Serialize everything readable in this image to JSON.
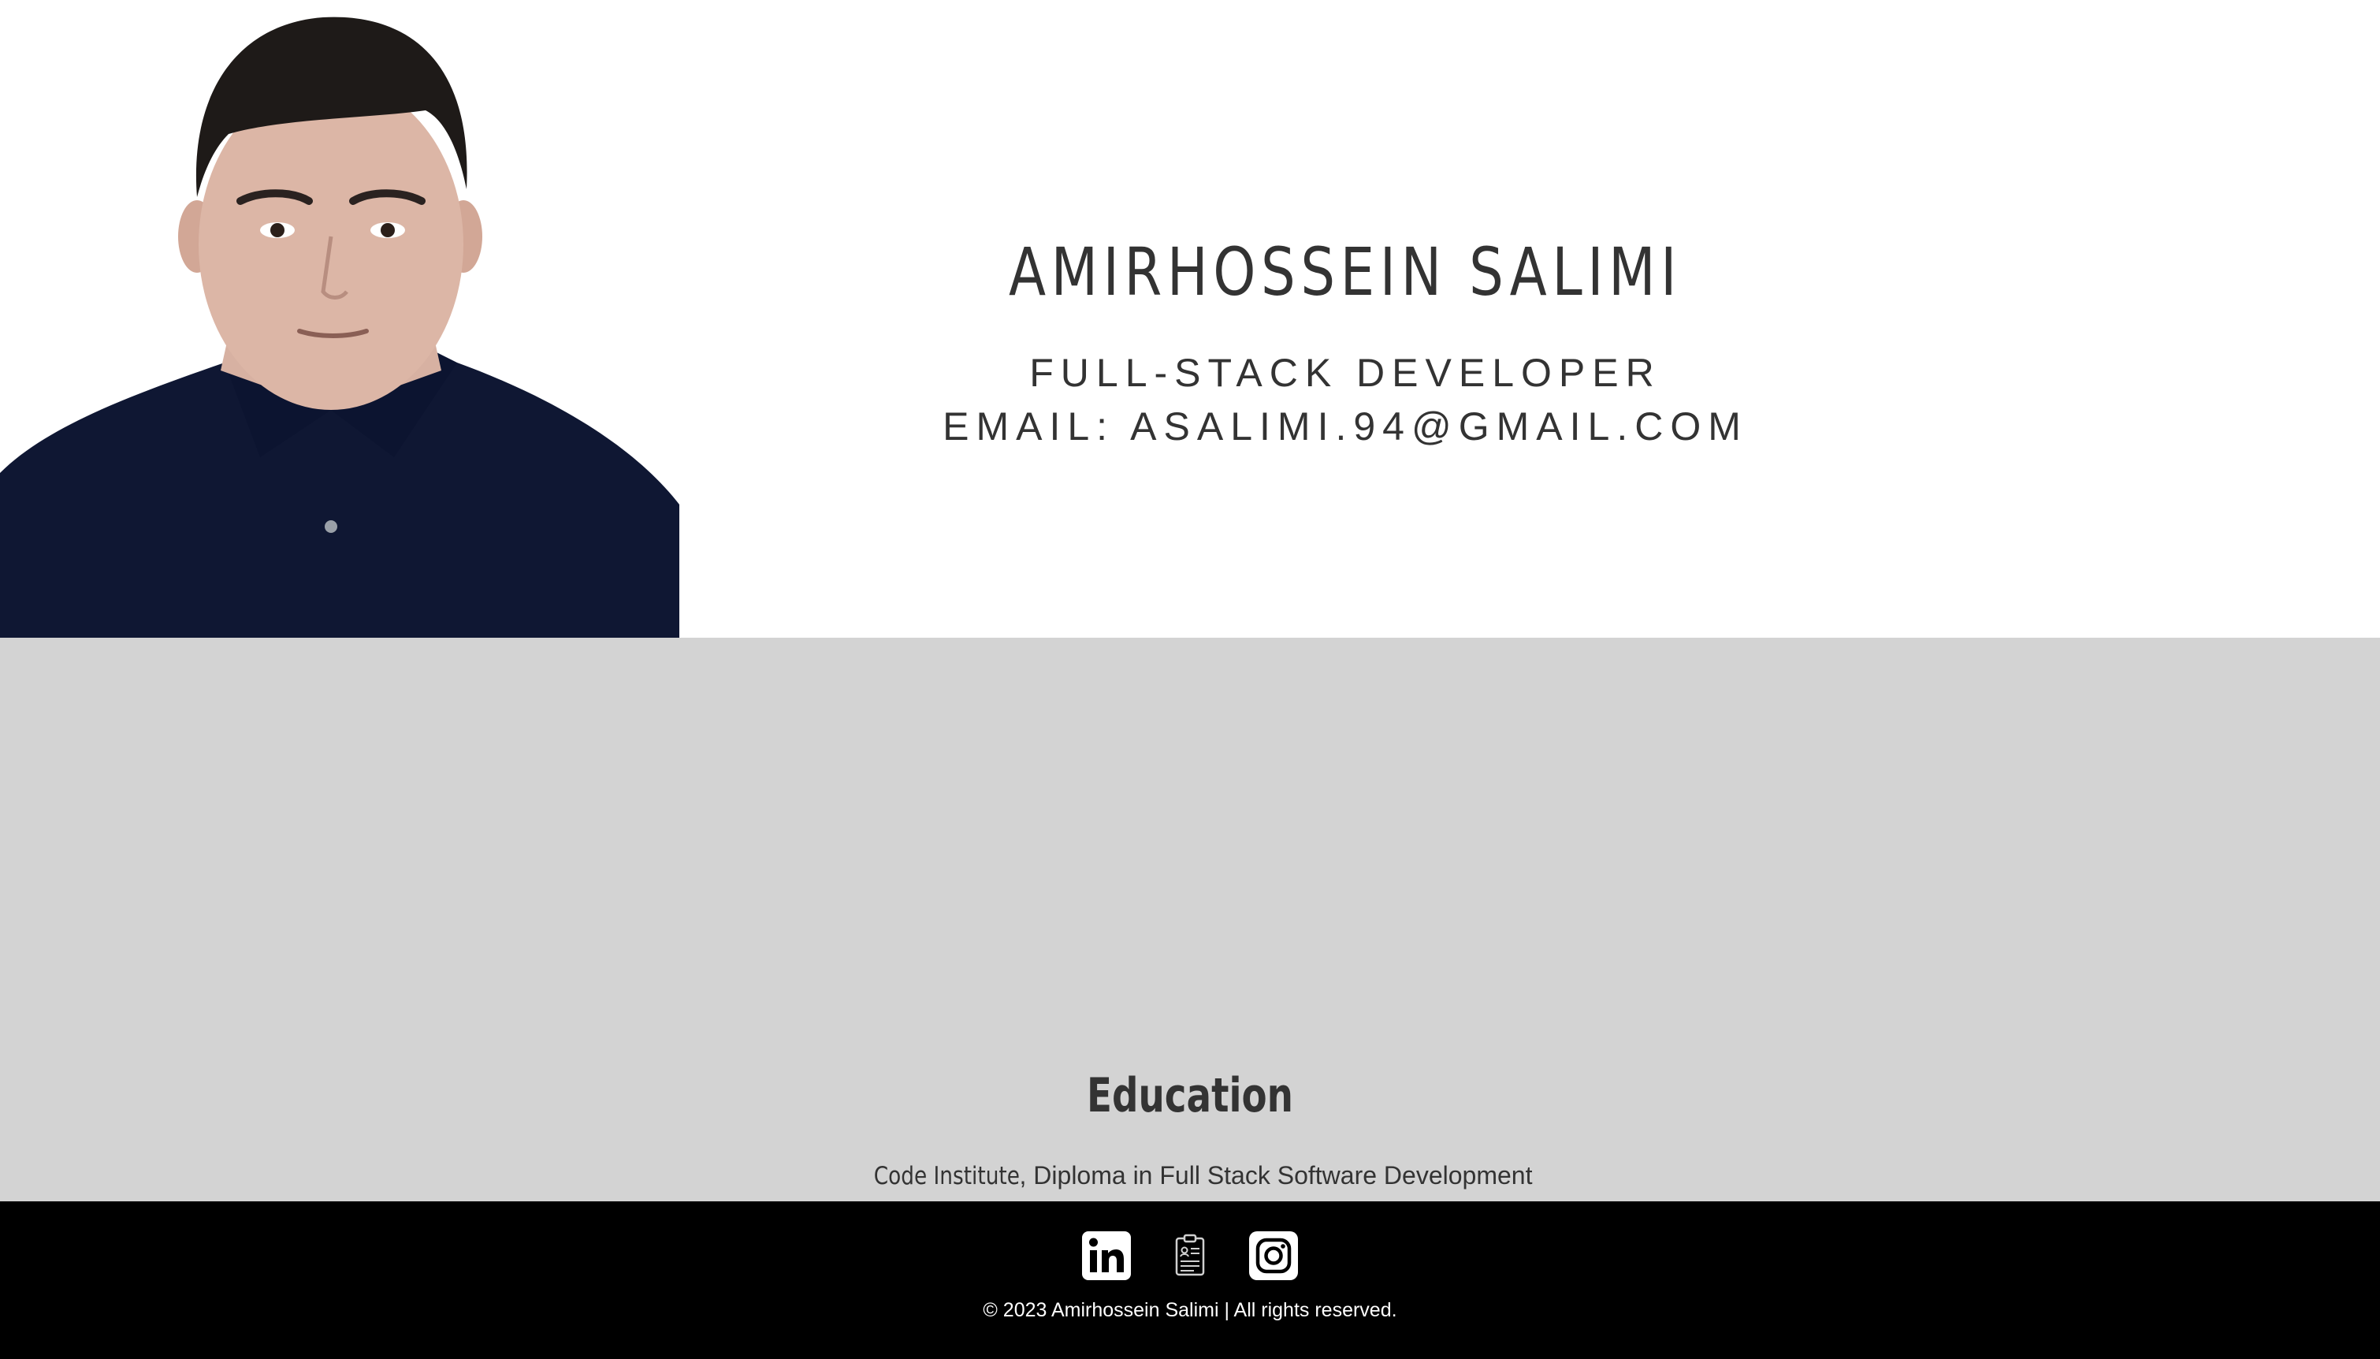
{
  "hero": {
    "name": "AMIRHOSSEIN SALIMI",
    "role": "FULL-STACK DEVELOPER",
    "email": "EMAIL: ASALIMI.94@GMAIL.COM",
    "photo_icon": "profile-photo"
  },
  "education": {
    "heading": "Education",
    "institution": "Code Institute",
    "separator": ",",
    "program": " Diploma in Full Stack Software Development"
  },
  "footer": {
    "icons": [
      "linkedin-icon",
      "resume-icon",
      "instagram-icon"
    ],
    "copyright": "© 2023 Amirhossein Salimi | All rights reserved."
  },
  "colors": {
    "text": "#333333",
    "grey_band": "#d3d3d3",
    "footer_bg": "#000000",
    "shirt": "#111a3a"
  }
}
